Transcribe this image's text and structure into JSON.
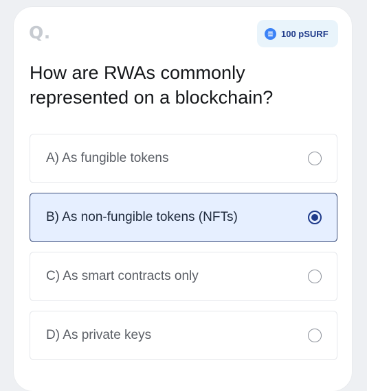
{
  "header": {
    "q_label": "Q.",
    "reward": {
      "icon": "coin-icon",
      "text": "100 pSURF",
      "accent_color": "#3b82f6"
    }
  },
  "question": {
    "text": "How are RWAs commonly represented on a blockchain?"
  },
  "options": [
    {
      "label": "A) As fungible tokens",
      "selected": false
    },
    {
      "label": "B) As non-fungible tokens (NFTs)",
      "selected": true
    },
    {
      "label": "C) As smart contracts only",
      "selected": false
    },
    {
      "label": "D) As private keys",
      "selected": false
    }
  ],
  "colors": {
    "selected_bg": "#e6efff",
    "selected_border": "#3b4d7a",
    "radio_checked": "#1e3a8a"
  }
}
